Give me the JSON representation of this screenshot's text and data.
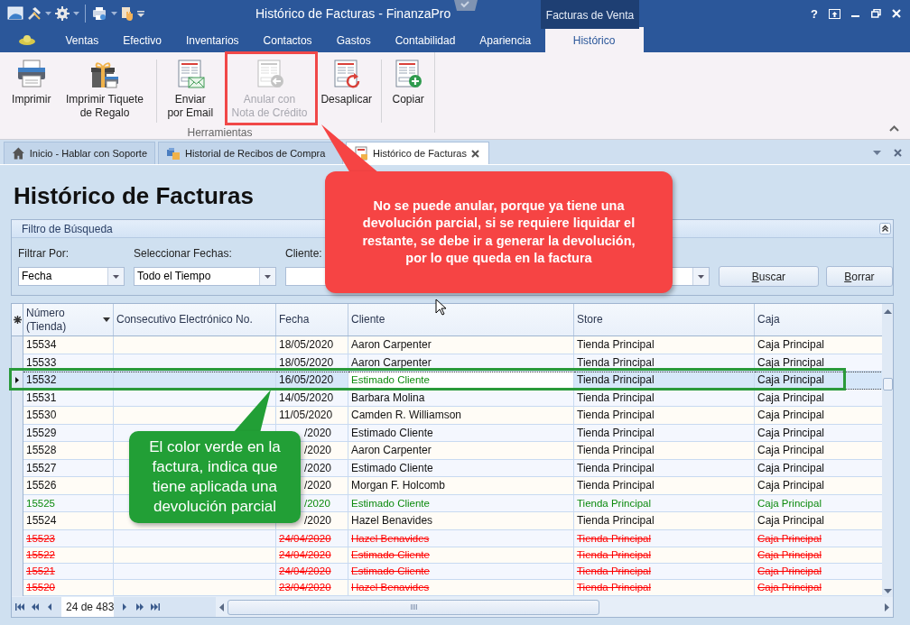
{
  "window": {
    "title": "Histórico de Facturas - FinanzaPro",
    "context_tab": "Facturas de Venta",
    "help": "?"
  },
  "ribbon": {
    "tabs": [
      {
        "label": "Ventas",
        "selected": false
      },
      {
        "label": "Efectivo",
        "selected": false
      },
      {
        "label": "Inventarios",
        "selected": false
      },
      {
        "label": "Contactos",
        "selected": false
      },
      {
        "label": "Gastos",
        "selected": false
      },
      {
        "label": "Contabilidad",
        "selected": false
      },
      {
        "label": "Apariencia",
        "selected": false
      },
      {
        "label": "Histórico",
        "selected": true
      }
    ],
    "group": {
      "label": "Herramientas",
      "buttons": [
        {
          "label": "Imprimir",
          "kind": "printer",
          "disabled": false,
          "separator_after": false
        },
        {
          "label": "Imprimir Tiquete\nde Regalo",
          "kind": "gift",
          "disabled": false,
          "separator_after": true
        },
        {
          "label": "Enviar\npor Email",
          "kind": "email",
          "disabled": false,
          "separator_after": false
        },
        {
          "label": "Anular con\nNota de Crédito",
          "kind": "void",
          "disabled": true,
          "separator_after": false
        },
        {
          "label": "Desaplicar",
          "kind": "undo",
          "disabled": false,
          "separator_after": true
        },
        {
          "label": "Copiar",
          "kind": "copy",
          "disabled": false,
          "separator_after": true
        }
      ]
    }
  },
  "doc_tabs": [
    {
      "label": "Inicio - Hablar con Soporte",
      "kind": "home",
      "selected": false
    },
    {
      "label": "Historial de Recibos de Compra",
      "kind": "receipts",
      "selected": false
    },
    {
      "label": "Histórico de Facturas",
      "kind": "invoice",
      "selected": true
    }
  ],
  "page": {
    "heading": "Histórico de Facturas"
  },
  "filter": {
    "title": "Filtro de Búsqueda",
    "fields": [
      {
        "label": "Filtrar Por:",
        "value": "Fecha",
        "kind": "combo"
      },
      {
        "label": "Seleccionar Fechas:",
        "value": "Todo el Tiempo",
        "kind": "combo"
      },
      {
        "label": "Cliente:",
        "kind": "wide_combo"
      }
    ],
    "buttons": [
      "Buscar",
      "Borrar"
    ]
  },
  "table": {
    "columns": [
      {
        "label": "Número\n(Tienda)",
        "sorted": true
      },
      {
        "label": "Consecutivo Electrónico No.",
        "sorted": false
      },
      {
        "label": "Fecha",
        "sorted": false
      },
      {
        "label": "Cliente",
        "sorted": false
      },
      {
        "label": "Store",
        "sorted": false
      },
      {
        "label": "Caja",
        "sorted": false
      }
    ],
    "rows": [
      {
        "numero": "15534",
        "fecha": "18/05/2020",
        "cliente": "Aaron Carpenter",
        "store": "Tienda Principal",
        "caja": "Caja Principal",
        "kind": "normal",
        "selected": false,
        "clipped": false
      },
      {
        "numero": "15533",
        "fecha": "18/05/2020",
        "cliente": "Aaron Carpenter",
        "store": "Tienda Principal",
        "caja": "Caja Principal",
        "kind": "normal",
        "selected": false,
        "clipped": false
      },
      {
        "numero": "15532",
        "fecha": "16/05/2020",
        "cliente": "Estimado Cliente",
        "store": "Tienda Principal",
        "caja": "Caja Principal",
        "kind": "partial_return",
        "selected": true,
        "clipped": false
      },
      {
        "numero": "15531",
        "fecha": "14/05/2020",
        "cliente": "Barbara Molina",
        "store": "Tienda Principal",
        "caja": "Caja Principal",
        "kind": "normal",
        "selected": false,
        "clipped": false
      },
      {
        "numero": "15530",
        "fecha": "11/05/2020",
        "cliente": "Camden R. Williamson",
        "store": "Tienda Principal",
        "caja": "Caja Principal",
        "kind": "normal",
        "selected": false,
        "clipped": false
      },
      {
        "numero": "15529",
        "fecha": "/2020",
        "cliente": "Estimado Cliente",
        "store": "Tienda Principal",
        "caja": "Caja Principal",
        "kind": "normal",
        "selected": false,
        "clipped": true
      },
      {
        "numero": "15528",
        "fecha": "/2020",
        "cliente": "Aaron Carpenter",
        "store": "Tienda Principal",
        "caja": "Caja Principal",
        "kind": "normal",
        "selected": false,
        "clipped": true
      },
      {
        "numero": "15527",
        "fecha": "/2020",
        "cliente": "Estimado Cliente",
        "store": "Tienda Principal",
        "caja": "Caja Principal",
        "kind": "normal",
        "selected": false,
        "clipped": true
      },
      {
        "numero": "15526",
        "fecha": "/2020",
        "cliente": "Morgan F. Holcomb",
        "store": "Tienda Principal",
        "caja": "Caja Principal",
        "kind": "normal",
        "selected": false,
        "clipped": true
      },
      {
        "numero": "15525",
        "fecha": "/2020",
        "cliente": "Estimado Cliente",
        "store": "Tienda Principal",
        "caja": "Caja Principal",
        "kind": "partial_return",
        "selected": false,
        "clipped": true
      },
      {
        "numero": "15524",
        "fecha": "/2020",
        "cliente": "Hazel Benavides",
        "store": "Tienda Principal",
        "caja": "Caja Principal",
        "kind": "normal",
        "selected": false,
        "clipped": true
      },
      {
        "numero": "15523",
        "fecha": "24/04/2020",
        "cliente": "Hazel Benavides",
        "store": "Tienda Principal",
        "caja": "Caja Principal",
        "kind": "voided",
        "selected": false,
        "clipped": false
      },
      {
        "numero": "15522",
        "fecha": "24/04/2020",
        "cliente": "Estimado Cliente",
        "store": "Tienda Principal",
        "caja": "Caja Principal",
        "kind": "voided",
        "selected": false,
        "clipped": false
      },
      {
        "numero": "15521",
        "fecha": "24/04/2020",
        "cliente": "Estimado Cliente",
        "store": "Tienda Principal",
        "caja": "Caja Principal",
        "kind": "voided",
        "selected": false,
        "clipped": false
      },
      {
        "numero": "15520",
        "fecha": "23/04/2020",
        "cliente": "Hazel Benavides",
        "store": "Tienda Principal",
        "caja": "Caja Principal",
        "kind": "voided",
        "selected": false,
        "clipped": false
      }
    ],
    "pager": "24 de 483"
  },
  "annotations": [
    {
      "text": "No se puede anular, porque ya tiene una\ndevolución parcial, si se requiere liquidar el\nrestante, se debe ir a generar la devolución,\npor lo que queda en la factura",
      "color": "#f64444"
    },
    {
      "text": "El color verde en la\nfactura, indica que\ntiene aplicada una\ndevolución parcial",
      "color": "#229f36"
    }
  ]
}
